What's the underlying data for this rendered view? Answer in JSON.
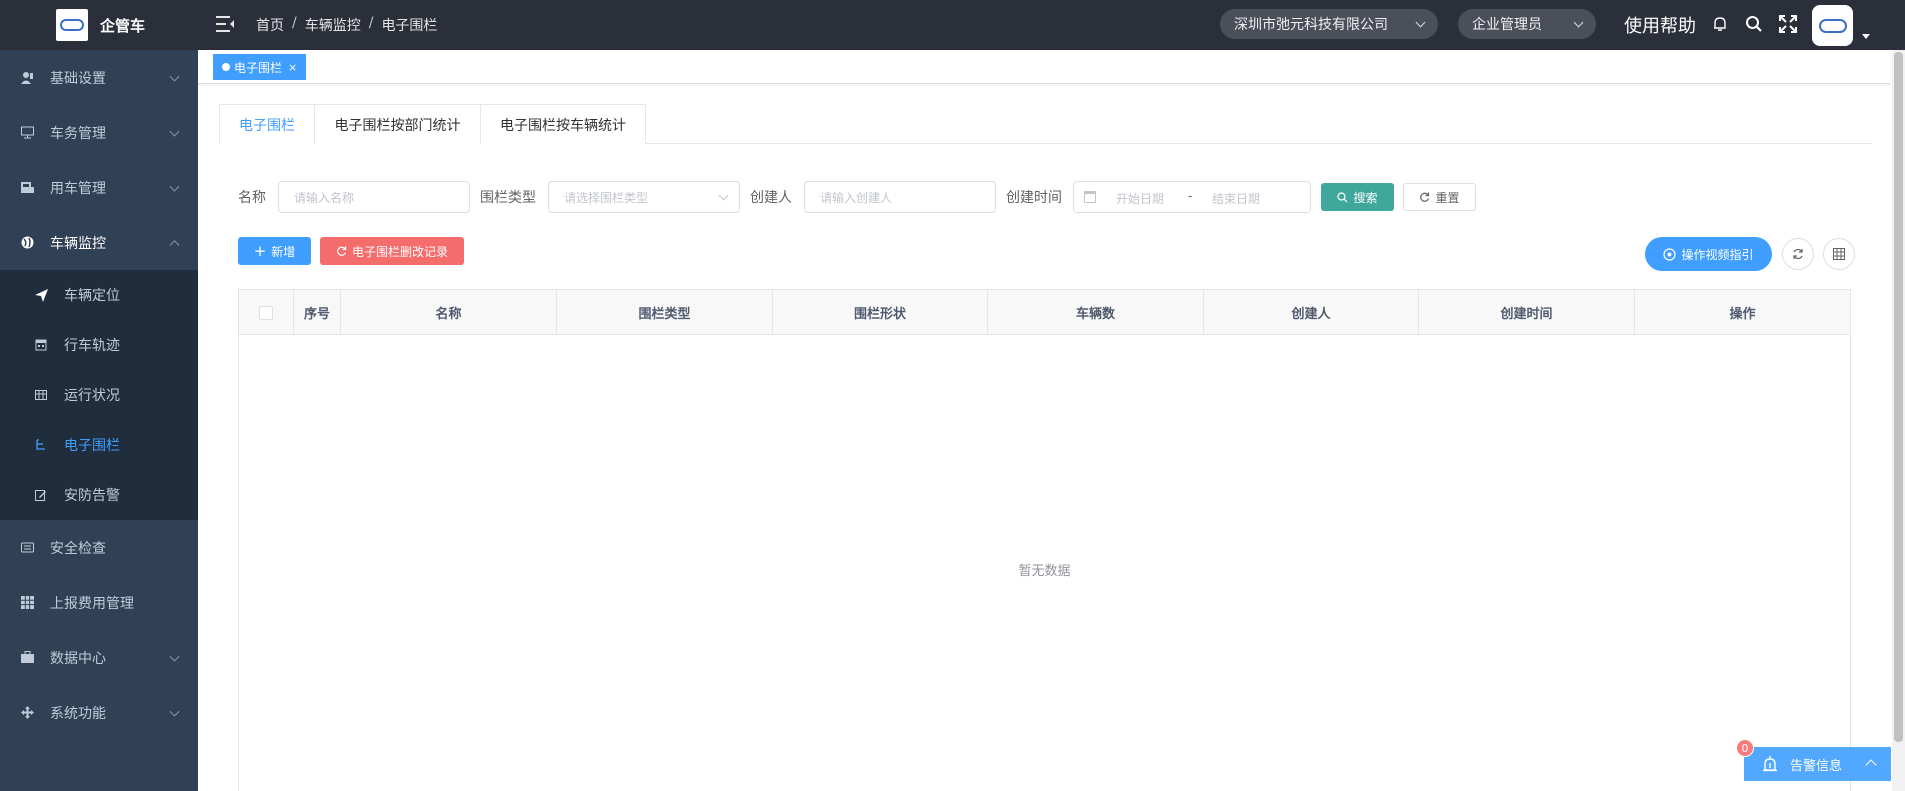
{
  "app": {
    "logo_text": "企管车"
  },
  "sidebar": {
    "items": [
      {
        "label": "基础设置",
        "icon": "user-settings-icon",
        "expandable": true
      },
      {
        "label": "车务管理",
        "icon": "monitor-icon",
        "expandable": true
      },
      {
        "label": "用车管理",
        "icon": "car-use-icon",
        "expandable": true
      },
      {
        "label": "车辆监控",
        "icon": "globe-icon",
        "expandable": true,
        "open": true
      },
      {
        "label": "安全检查",
        "icon": "check-card-icon",
        "expandable": false
      },
      {
        "label": "上报费用管理",
        "icon": "grid-icon",
        "expandable": false
      },
      {
        "label": "数据中心",
        "icon": "briefcase-icon",
        "expandable": true
      },
      {
        "label": "系统功能",
        "icon": "move-icon",
        "expandable": true
      }
    ],
    "submenu": [
      {
        "label": "车辆定位",
        "icon": "send-icon"
      },
      {
        "label": "行车轨迹",
        "icon": "calendar-icon"
      },
      {
        "label": "运行状况",
        "icon": "table-icon"
      },
      {
        "label": "电子围栏",
        "icon": "tree-icon",
        "active": true
      },
      {
        "label": "安防告警",
        "icon": "edit-icon"
      }
    ]
  },
  "navbar": {
    "breadcrumb": [
      "首页",
      "车辆监控",
      "电子围栏"
    ],
    "company": "深圳市弛元科技有限公司",
    "role": "企业管理员",
    "help": "使用帮助"
  },
  "tagsview": {
    "active_tag": "电子围栏",
    "close": "×"
  },
  "tabs": [
    "电子围栏",
    "电子围栏按部门统计",
    "电子围栏按车辆统计"
  ],
  "search": {
    "name_label": "名称",
    "name_placeholder": "请输入名称",
    "type_label": "围栏类型",
    "type_placeholder": "请选择围栏类型",
    "creator_label": "创建人",
    "creator_placeholder": "请输入创建人",
    "time_label": "创建时间",
    "start_placeholder": "开始日期",
    "range_sep": "-",
    "end_placeholder": "结束日期",
    "search_btn": "搜索",
    "reset_btn": "重置"
  },
  "toolbar": {
    "add_btn": "新增",
    "log_btn": "电子围栏删改记录",
    "guide_btn": "操作视频指引"
  },
  "table": {
    "columns": [
      "序号",
      "名称",
      "围栏类型",
      "围栏形状",
      "车辆数",
      "创建人",
      "创建时间",
      "操作"
    ],
    "empty_text": "暂无数据"
  },
  "alarm": {
    "label": "告警信息",
    "count": "0"
  }
}
